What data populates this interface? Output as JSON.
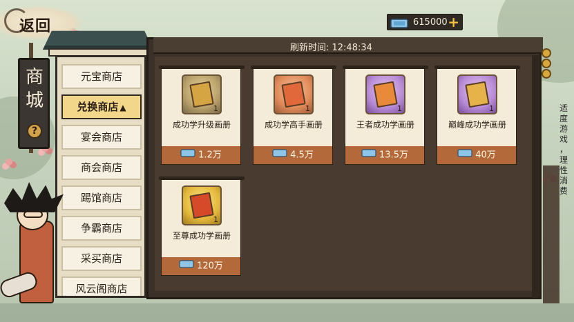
{
  "back": {
    "label": "返回"
  },
  "currency": {
    "amount": "615000",
    "plus": "+"
  },
  "banner": {
    "title_1": "商",
    "title_2": "城",
    "help": "?"
  },
  "refresh": {
    "text": "刷新时间: 12:48:34"
  },
  "categories": [
    {
      "label": "元宝商店"
    },
    {
      "label": "兑换商店",
      "active": true,
      "arrow": "^"
    },
    {
      "label": "宴会商店"
    },
    {
      "label": "商会商店"
    },
    {
      "label": "踢馆商店"
    },
    {
      "label": "争霸商店"
    },
    {
      "label": "采买商店"
    },
    {
      "label": "风云阁商店"
    }
  ],
  "items": [
    {
      "name": "成功学升级画册",
      "qty": "1",
      "price": "1.2万",
      "icon": "gold-book-icon"
    },
    {
      "name": "成功学高手画册",
      "qty": "1",
      "price": "4.5万",
      "icon": "orange-book-icon"
    },
    {
      "name": "王者成功学画册",
      "qty": "1",
      "price": "13.5万",
      "icon": "purple-book-icon"
    },
    {
      "name": "巅峰成功学画册",
      "qty": "1",
      "price": "40万",
      "icon": "purple-book-icon"
    },
    {
      "name": "至尊成功学画册",
      "qty": "1",
      "price": "120万",
      "icon": "yellow-book-icon"
    }
  ],
  "slogan": {
    "line_1": "适度游戏",
    "line_2": "，",
    "line_3": "理性消费"
  },
  "colors": {
    "accent": "#b4693a",
    "frame": "#3b3128",
    "active_tab": "#f2d68a"
  }
}
